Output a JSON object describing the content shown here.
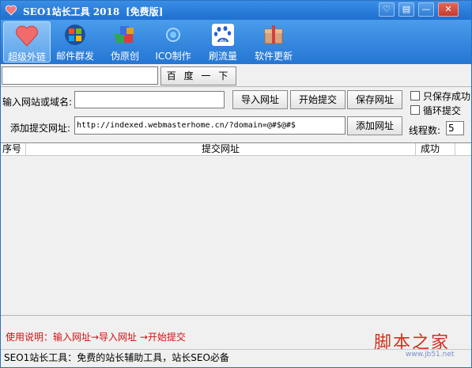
{
  "window": {
    "title": "SEO1站长工具 2018",
    "edition": "[免费版]",
    "controls": {
      "skin": "♡",
      "menu": "▤",
      "minimize": "—",
      "close": "✕"
    }
  },
  "toolbar": {
    "items": [
      {
        "label": "超级外链",
        "icon": "heart-icon",
        "active": true
      },
      {
        "label": "邮件群发",
        "icon": "windows-logo-icon",
        "active": false
      },
      {
        "label": "伪原创",
        "icon": "blocks-icon",
        "active": false
      },
      {
        "label": "ICO制作",
        "icon": "target-icon",
        "active": false
      },
      {
        "label": "刷流量",
        "icon": "baidu-paw-icon",
        "active": false
      },
      {
        "label": "软件更新",
        "icon": "package-icon",
        "active": false
      }
    ]
  },
  "search": {
    "value": "",
    "button": "百 度 一 下"
  },
  "form": {
    "site_label": "输入网站或域名:",
    "site_value": "",
    "import_button": "导入网址",
    "start_button": "开始提交",
    "save_button": "保存网址",
    "url_label": "添加提交网址:",
    "url_value": "http://indexed.webmasterhome.cn/?domain=@#$@#$",
    "add_button": "添加网址",
    "only_success_label": "只保存成功",
    "only_success_checked": false,
    "loop_label": "循环提交",
    "loop_checked": false,
    "threads_label": "线程数:",
    "threads_value": "5"
  },
  "table": {
    "columns": [
      "序号",
      "提交网址",
      "成功"
    ],
    "rows": []
  },
  "usage_text": "使用说明：输入网址→导入网址 →开始提交",
  "watermark": {
    "main": "脚本之家",
    "sub": "www.jb51.net"
  },
  "status_text": "SEO1站长工具：免费的站长辅助工具，站长SEO必备",
  "colors": {
    "titlebar": "#2476d3",
    "usage_text": "#d01010",
    "watermark": "#d2301e"
  }
}
